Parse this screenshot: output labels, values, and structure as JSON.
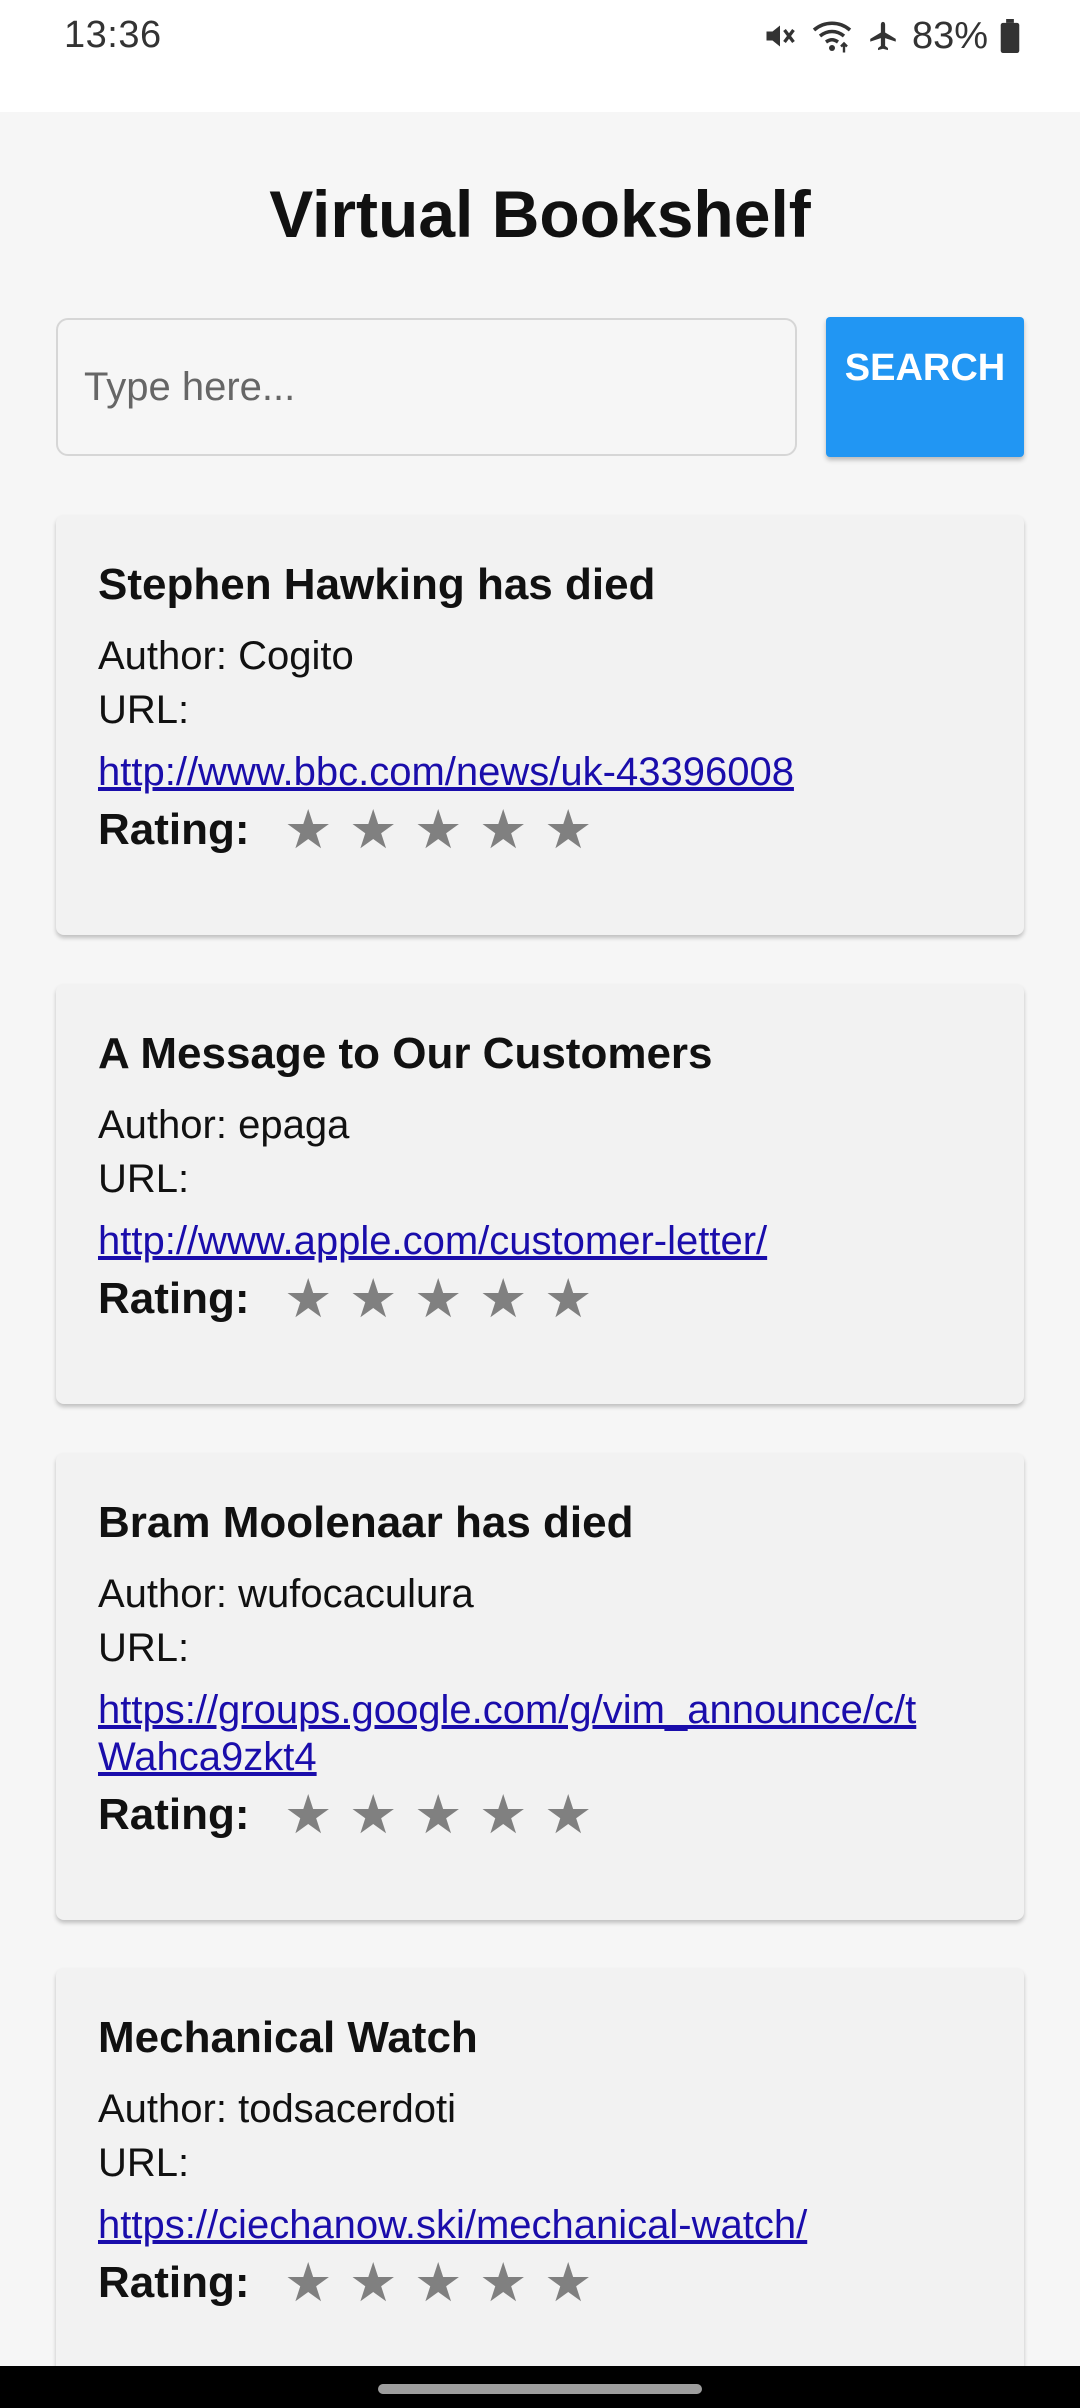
{
  "status_bar": {
    "time": "13:36",
    "battery": "83%",
    "icons": [
      "mute-icon",
      "wifi-icon",
      "airplane-mode-icon",
      "battery-icon"
    ]
  },
  "app": {
    "title": "Virtual Bookshelf",
    "search": {
      "placeholder": "Type here...",
      "value": "",
      "button_label": "SEARCH"
    },
    "colors": {
      "accent": "#2196f3",
      "link": "#1a0dab",
      "star": "#808080"
    },
    "cards": [
      {
        "title": "Stephen Hawking has died",
        "author": "Author: Cogito",
        "url_label": "URL:",
        "url": "http://www.bbc.com/news/uk-43396008",
        "rating_label": "Rating:",
        "stars": [
          "★",
          "★",
          "★",
          "★",
          "★"
        ]
      },
      {
        "title": "A Message to Our Customers",
        "author": "Author: epaga",
        "url_label": "URL:",
        "url": "http://www.apple.com/customer-letter/",
        "rating_label": "Rating:",
        "stars": [
          "★",
          "★",
          "★",
          "★",
          "★"
        ]
      },
      {
        "title": "Bram Moolenaar has died",
        "author": "Author: wufocaculura",
        "url_label": "URL:",
        "url": "https://groups.google.com/g/vim_announce/c/tWahca9zkt4",
        "rating_label": "Rating:",
        "stars": [
          "★",
          "★",
          "★",
          "★",
          "★"
        ]
      },
      {
        "title": "Mechanical Watch",
        "author": "Author: todsacerdoti",
        "url_label": "URL:",
        "url": "https://ciechanow.ski/mechanical-watch/",
        "rating_label": "Rating:",
        "stars": [
          "★",
          "★",
          "★",
          "★",
          "★"
        ]
      }
    ]
  }
}
